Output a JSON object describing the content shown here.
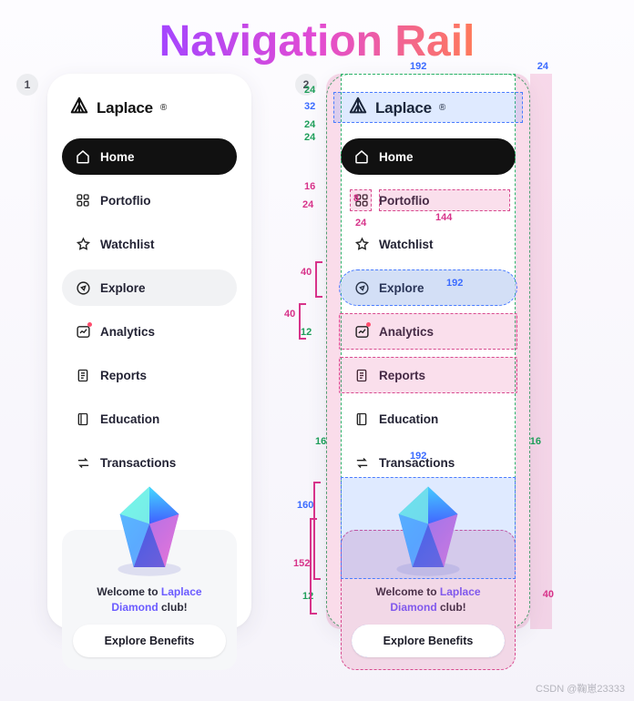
{
  "title": "Navigation Rail",
  "badges": {
    "one": "1",
    "two": "2"
  },
  "brand": {
    "name": "Laplace",
    "mark": "®"
  },
  "nav": {
    "items": [
      {
        "label": "Home",
        "name": "home",
        "state": "active"
      },
      {
        "label": "Portoflio",
        "name": "portfolio",
        "state": ""
      },
      {
        "label": "Watchlist",
        "name": "watchlist",
        "state": ""
      },
      {
        "label": "Explore",
        "name": "explore",
        "state": "hover"
      },
      {
        "label": "Analytics",
        "name": "analytics",
        "state": ""
      },
      {
        "label": "Reports",
        "name": "reports",
        "state": ""
      },
      {
        "label": "Education",
        "name": "education",
        "state": ""
      },
      {
        "label": "Transactions",
        "name": "transactions",
        "state": ""
      }
    ]
  },
  "promo": {
    "welcome_prefix": "Welcome to ",
    "brand_line1": "Laplace",
    "brand_line2": "Diamond",
    "club_suffix": " club!",
    "cta": "Explore Benefits"
  },
  "specs": {
    "rail_width": "224",
    "inner_width": "192",
    "side_pad": "16",
    "top_pad": "24",
    "logo_h": "32",
    "gap_logo_nav": "24",
    "item_h": "40",
    "item_gap": "12",
    "icon_right_gap": "8",
    "icon_area": "24",
    "icon_left_inset": "16",
    "label_w": "144",
    "promo_h": "152",
    "diamond_h": "160",
    "promo_btn_h": "40",
    "promo_inner_pad": "12",
    "col_right": "24"
  },
  "watermark": "CSDN @鞠崽23333"
}
